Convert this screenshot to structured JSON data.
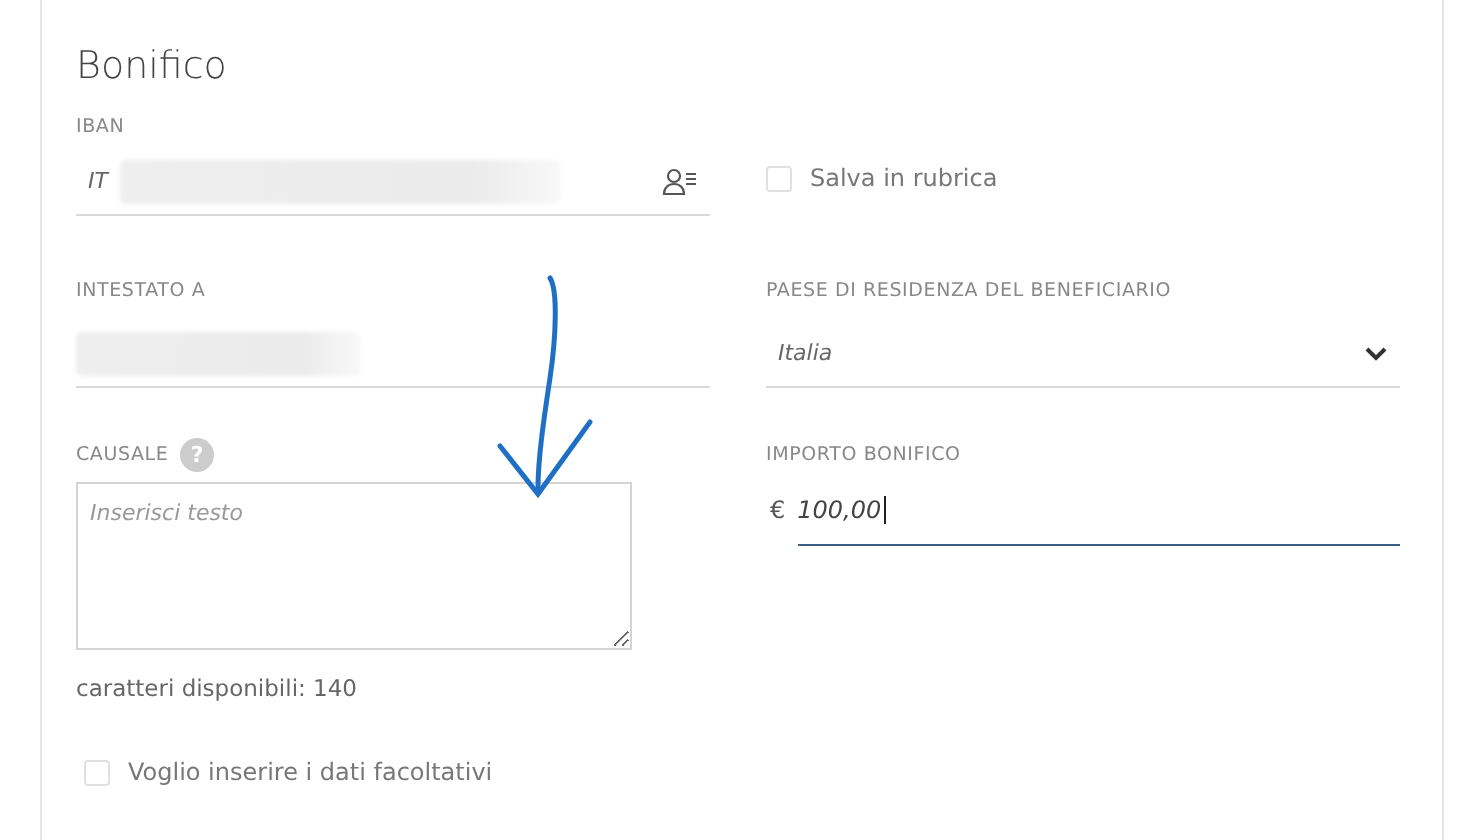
{
  "title": "Bonifico",
  "iban": {
    "label": "IBAN",
    "value": "IT",
    "redacted": true
  },
  "save_to_contacts": {
    "label": "Salva in rubrica",
    "checked": false
  },
  "beneficiary": {
    "label": "INTESTATO A",
    "redacted": true
  },
  "country": {
    "label": "PAESE DI RESIDENZA DEL BENEFICIARIO",
    "value": "Italia"
  },
  "reason": {
    "label": "CAUSALE",
    "help": "?",
    "placeholder": "Inserisci testo",
    "counter": "caratteri disponibili: 140"
  },
  "amount": {
    "label": "IMPORTO BONIFICO",
    "currency": "€",
    "value": "100,00",
    "focused": true
  },
  "optional_data": {
    "label": "Voglio inserire i dati facoltativi",
    "checked": false
  }
}
